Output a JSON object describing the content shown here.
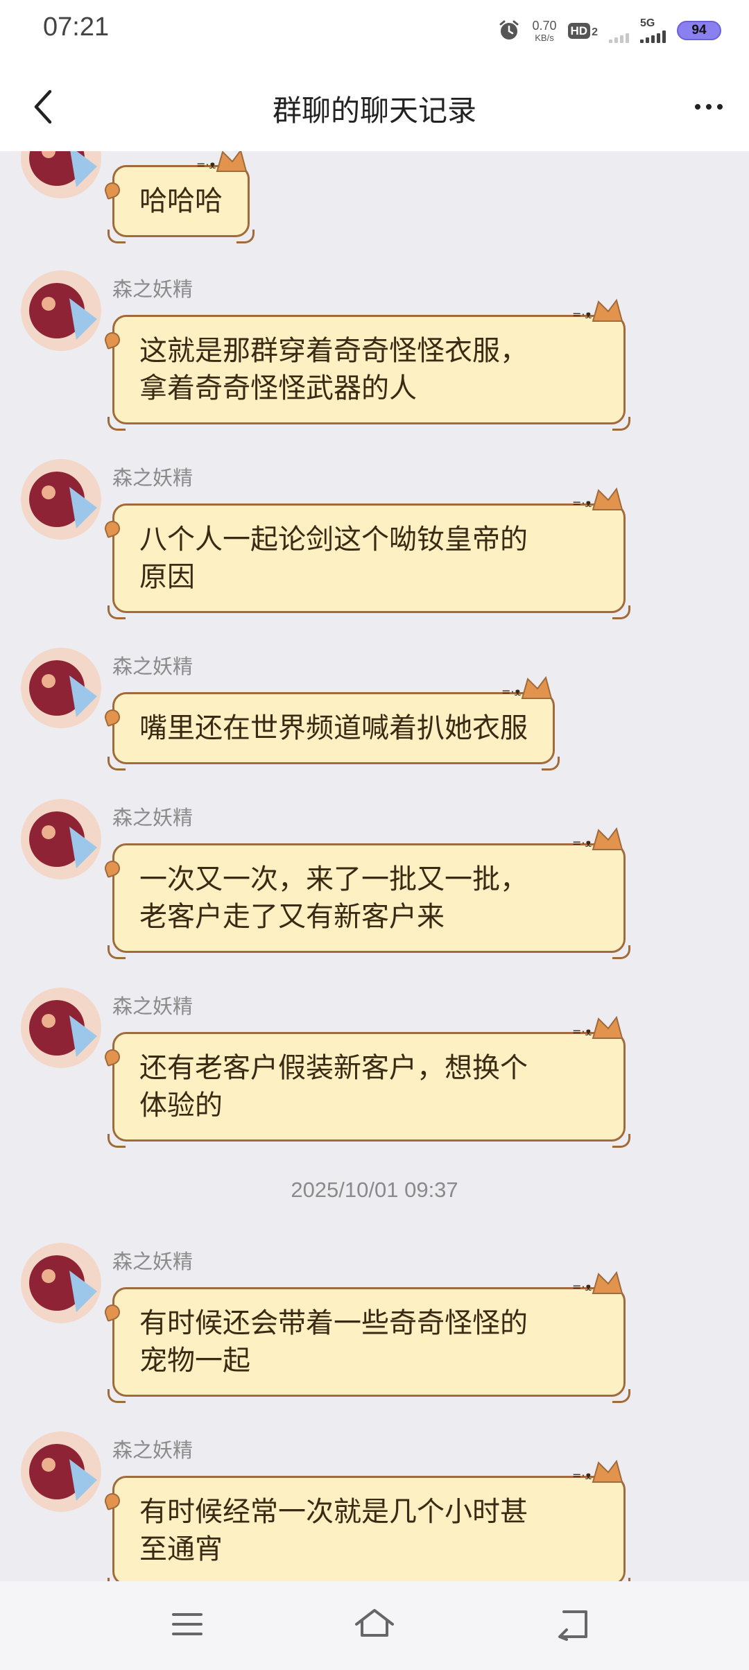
{
  "status_bar": {
    "time": "07:21",
    "net_speed_value": "0.70",
    "net_speed_unit": "KB/s",
    "hd_label": "HD",
    "hd_sim": "2",
    "network_type": "5G",
    "battery": "94",
    "battery_color": "#8a80f0"
  },
  "header": {
    "title": "群聊的聊天记录",
    "back_icon": "chevron-left-icon",
    "more_icon": "more-horizontal-icon"
  },
  "chat": {
    "accent_bubble_color": "#fdf0c2",
    "messages": [
      {
        "sender": "",
        "text": "哈哈哈"
      },
      {
        "sender": "森之妖精",
        "lines": [
          "这就是那群穿着奇奇怪怪衣服，",
          "拿着奇奇怪怪武器的人"
        ]
      },
      {
        "sender": "森之妖精",
        "lines": [
          "八个人一起论剑这个呦钕皇帝的",
          "原因"
        ]
      },
      {
        "sender": "森之妖精",
        "text": "嘴里还在世界频道喊着扒她衣服"
      },
      {
        "sender": "森之妖精",
        "lines": [
          "一次又一次，来了一批又一批，",
          "老客户走了又有新客户来"
        ]
      },
      {
        "sender": "森之妖精",
        "lines": [
          "还有老客户假装新客户，想换个",
          "体验的"
        ]
      },
      {
        "sender": "森之妖精",
        "lines": [
          "有时候还会带着一些奇奇怪怪的",
          "宠物一起"
        ]
      },
      {
        "sender": "森之妖精",
        "lines": [
          "有时候经常一次就是几个小时甚",
          "至通宵"
        ]
      }
    ],
    "timestamp": "2025/10/01 09:37"
  },
  "nav": {
    "menu_icon": "menu-icon",
    "home_icon": "home-icon",
    "back_icon": "back-icon"
  }
}
